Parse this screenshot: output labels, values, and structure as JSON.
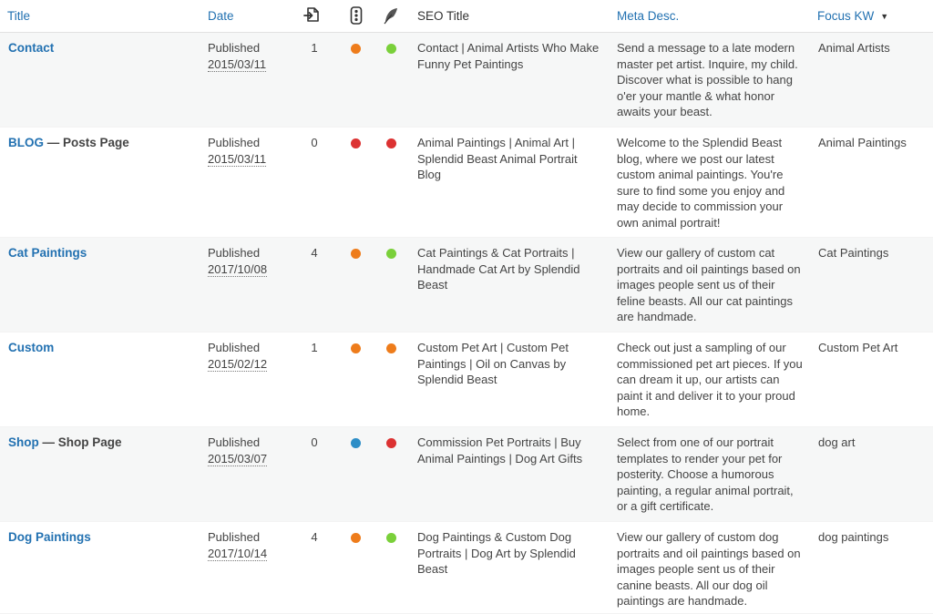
{
  "colors": {
    "link": "#2271b1",
    "orange": "#ee7c1b",
    "green": "#7ad03a",
    "red": "#dc3232",
    "blue": "#2d8ec7"
  },
  "header": {
    "title": "Title",
    "date": "Date",
    "links_icon": "internal-links-icon",
    "readability_icon": "traffic-light-icon",
    "seo_icon": "feather-icon",
    "seo_title": "SEO Title",
    "meta_desc": "Meta Desc.",
    "focus_kw": "Focus KW",
    "sort_indicator": "▼"
  },
  "rows": [
    {
      "title": "Contact",
      "state": "",
      "status": "Published",
      "date": "2015/03/11",
      "links": "1",
      "readability": "orange",
      "seo": "green",
      "seo_title": "Contact | Animal Artists Who Make Funny Pet Paintings",
      "meta_desc": "Send a message to a late modern master pet artist. Inquire, my child. Discover what is possible to hang o'er your mantle & what honor awaits your beast.",
      "focus_kw": "Animal Artists"
    },
    {
      "title": "BLOG",
      "state": " — Posts Page",
      "status": "Published",
      "date": "2015/03/11",
      "links": "0",
      "readability": "red",
      "seo": "red",
      "seo_title": "Animal Paintings | Animal Art | Splendid Beast Animal Portrait Blog",
      "meta_desc": "Welcome to the Splendid Beast blog, where we post our latest custom animal paintings. You're sure to find some you enjoy and may decide to commission your own animal portrait!",
      "focus_kw": "Animal Paintings"
    },
    {
      "title": "Cat Paintings",
      "state": "",
      "status": "Published",
      "date": "2017/10/08",
      "links": "4",
      "readability": "orange",
      "seo": "green",
      "seo_title": "Cat Paintings & Cat Portraits | Handmade Cat Art by Splendid Beast",
      "meta_desc": "View our gallery of custom cat portraits and oil paintings based on images people sent us of their feline beasts. All our cat paintings are handmade.",
      "focus_kw": "Cat Paintings"
    },
    {
      "title": "Custom",
      "state": "",
      "status": "Published",
      "date": "2015/02/12",
      "links": "1",
      "readability": "orange",
      "seo": "orange",
      "seo_title": "Custom Pet Art | Custom Pet Paintings | Oil on Canvas by Splendid Beast",
      "meta_desc": "Check out just a sampling of our commissioned pet art pieces. If you can dream it up, our artists can paint it and deliver it to your proud home.",
      "focus_kw": "Custom Pet Art"
    },
    {
      "title": "Shop",
      "state": " — Shop Page",
      "status": "Published",
      "date": "2015/03/07",
      "links": "0",
      "readability": "blue",
      "seo": "red",
      "seo_title": "Commission Pet Portraits | Buy Animal Paintings | Dog Art Gifts",
      "meta_desc": "Select from one of our portrait templates to render your pet for posterity. Choose a humorous painting, a regular animal portrait, or a gift certificate.",
      "focus_kw": "dog art"
    },
    {
      "title": "Dog Paintings",
      "state": "",
      "status": "Published",
      "date": "2017/10/14",
      "links": "4",
      "readability": "orange",
      "seo": "green",
      "seo_title": "Dog Paintings & Custom Dog Portraits | Dog Art by Splendid Beast",
      "meta_desc": "View our gallery of custom dog portraits and oil paintings based on images people sent us of their canine beasts. All our dog oil paintings are handmade.",
      "focus_kw": "dog paintings"
    }
  ]
}
